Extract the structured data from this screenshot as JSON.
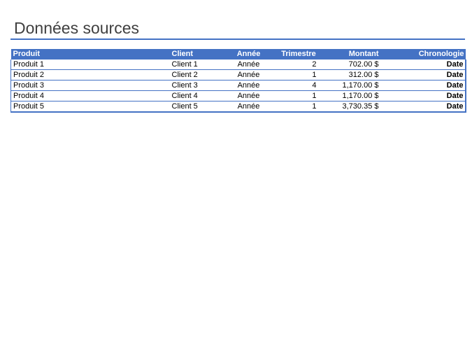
{
  "title": "Données sources",
  "colors": {
    "accent": "#4472c4",
    "title_text": "#404040"
  },
  "table": {
    "headers": [
      "Produit",
      "Client",
      "Année",
      "Trimestre",
      "Montant",
      "Chronologie"
    ],
    "rows": [
      {
        "produit": "Produit 1",
        "client": "Client 1",
        "annee": "Année",
        "trimestre": "2",
        "montant": "702.00 $",
        "chronologie": "Date"
      },
      {
        "produit": "Produit 2",
        "client": "Client 2",
        "annee": "Année",
        "trimestre": "1",
        "montant": "312.00 $",
        "chronologie": "Date"
      },
      {
        "produit": "Produit 3",
        "client": "Client 3",
        "annee": "Année",
        "trimestre": "4",
        "montant": "1,170.00 $",
        "chronologie": "Date"
      },
      {
        "produit": "Produit 4",
        "client": "Client 4",
        "annee": "Année",
        "trimestre": "1",
        "montant": "1,170.00 $",
        "chronologie": "Date"
      },
      {
        "produit": "Produit 5",
        "client": "Client 5",
        "annee": "Année",
        "trimestre": "1",
        "montant": "3,730.35 $",
        "chronologie": "Date"
      }
    ]
  }
}
